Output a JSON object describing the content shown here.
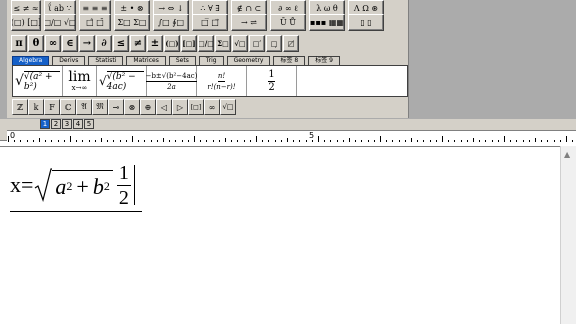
{
  "toolbar": {
    "row1": [
      "≤ ≠ ≈",
      "ΐ ab ∵",
      "≡ ≡ ≡",
      "± • ⊗",
      "→ ⇔ ↓",
      "∴ ∀ ∃",
      "∉ ∩ ⊂",
      "∂ ∞ ℓ",
      "λ ω θ",
      "Λ Ω ⊛"
    ],
    "row2": [
      "(□) [□]",
      "□/□ √□",
      "□̂ □̄",
      "Σ□ Σ□",
      "∫□ ∮□",
      "□̅ □⃗",
      "→ ⇌",
      "Ū Ů",
      "▪▪▪ ▦▦",
      "▯ ▯"
    ],
    "row3": [
      "π",
      "θ",
      "∞",
      "∈",
      "→",
      "∂",
      "≤",
      "≠",
      "±",
      "(□)",
      "[□]",
      "□/□",
      "Σ□",
      "√□",
      "□′",
      "□̣",
      "□̸"
    ],
    "tabs": [
      "Algebra",
      "Derivs",
      "Statisti",
      "Matrices",
      "Sets",
      "Trig",
      "Geometry",
      "标签 8",
      "标签 9"
    ],
    "active_tab": "Algebra",
    "templates": {
      "t1": "√(a² + b²)",
      "t2_top": "lim",
      "t2_bot": "x→∞",
      "t3": "√(b² − 4ac)",
      "t4_num": "−b±√(b²−4ac)",
      "t4_den": "2a",
      "t5_num": "n!",
      "t5_den": "r!(n−r)!",
      "t6_num": "1",
      "t6_den": "2"
    },
    "small_row": [
      "ℤ",
      "k",
      "F",
      "ℂ",
      "𝔄",
      "𝔐",
      "⊸",
      "⊗",
      "⊕",
      "◁",
      "▷",
      "[□]",
      "∞",
      "√□"
    ],
    "size_buttons": [
      "1",
      "2",
      "3",
      "4",
      "5"
    ]
  },
  "ruler": {
    "label_0": "0",
    "label_5": "5"
  },
  "equation": {
    "lhs": "x=",
    "radicand_a": "a",
    "exp_a": "2",
    "plus": "+",
    "radicand_b": "b",
    "exp_b": "2",
    "frac_num": "1",
    "frac_den": "2"
  }
}
